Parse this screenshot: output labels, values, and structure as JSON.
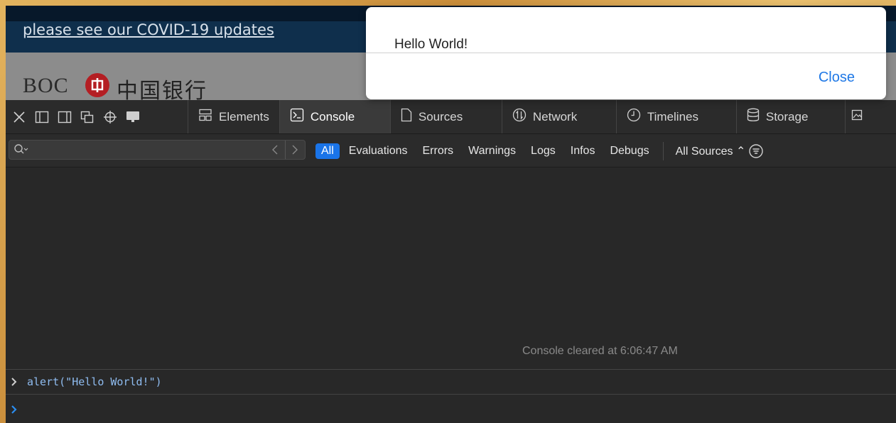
{
  "webpage": {
    "covid_link": "please see our COVID-19 updates",
    "brand_text": "BOC",
    "brand_chinese": "中国银行"
  },
  "alert": {
    "message": "Hello World!",
    "close_label": "Close"
  },
  "devtools": {
    "toolbar_icons": [
      "close-icon",
      "dock-bottom-icon",
      "dock-side-icon",
      "undock-icon",
      "crosshair-icon",
      "device-icon"
    ],
    "tabs": [
      {
        "label": "Elements",
        "icon": "elements-icon",
        "active": false
      },
      {
        "label": "Console",
        "icon": "console-icon",
        "active": true
      },
      {
        "label": "Sources",
        "icon": "document-icon",
        "active": false
      },
      {
        "label": "Network",
        "icon": "network-icon",
        "active": false
      },
      {
        "label": "Timelines",
        "icon": "clock-icon",
        "active": false
      },
      {
        "label": "Storage",
        "icon": "database-icon",
        "active": false
      }
    ],
    "filter": {
      "search_value": "",
      "levels": [
        "All",
        "Evaluations",
        "Errors",
        "Warnings",
        "Logs",
        "Infos",
        "Debugs"
      ],
      "selected_level": "All",
      "sources": "All Sources ⌃"
    },
    "console": {
      "cleared_message": "Console cleared at 6:06:47 AM",
      "last_command": "alert(\"Hello World!\")",
      "input_value": ""
    }
  },
  "colors": {
    "accent": "#1a74e8",
    "devtools_bg": "#282828",
    "alert_button": "#1f78e6",
    "command_text": "#8fbcf0"
  }
}
